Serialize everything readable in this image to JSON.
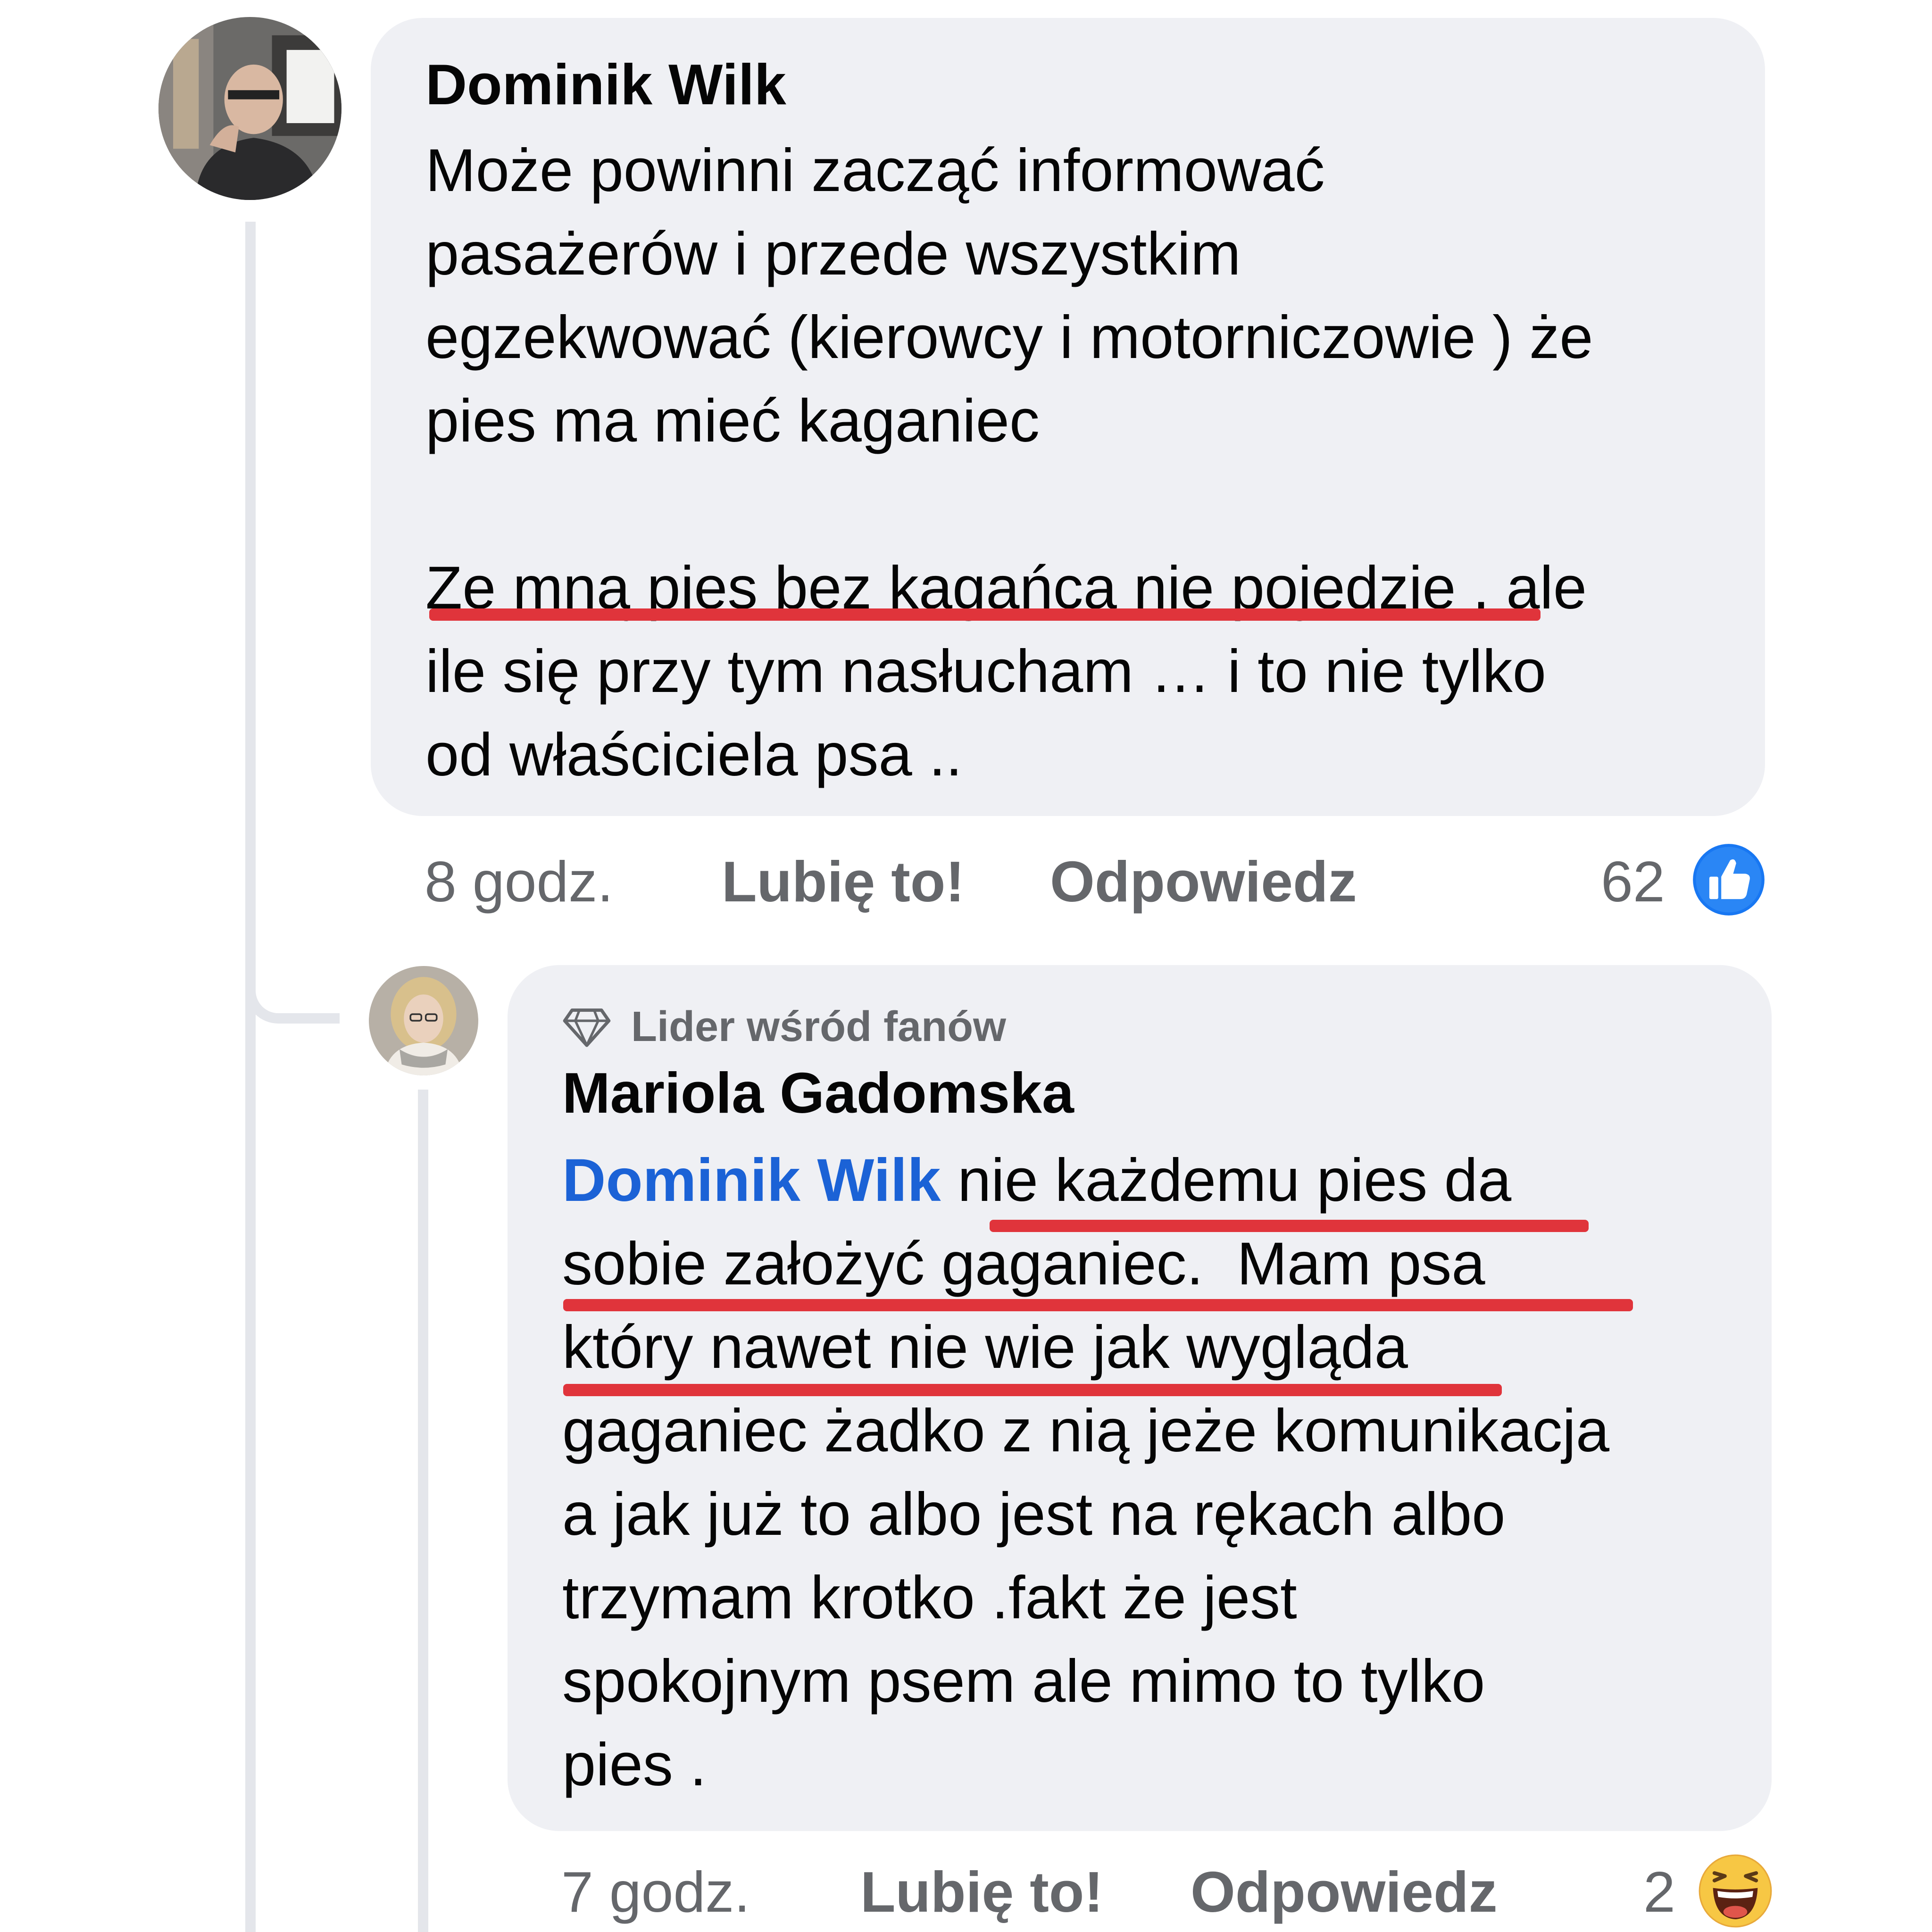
{
  "comments": [
    {
      "author": "Dominik Wilk",
      "text_lines": [
        "Może powinni zacząć informować",
        "pasażerów i przede wszystkim",
        "egzekwować (kierowcy i motorniczowie ) że",
        "pies ma mieć kaganiec"
      ],
      "text_lines_2": [
        "Ze mną pies bez kagańca nie pojedzie , ale",
        "ile się przy tym nasłucham … i to nie tylko",
        "od właściciela psa .."
      ],
      "time": "8 godz.",
      "like_label": "Lubię to!",
      "reply_label": "Odpowiedz",
      "reaction_count": "62",
      "reaction_icon": "like-icon"
    },
    {
      "badge": "Lider wśród fanów",
      "badge_icon": "diamond-icon",
      "author": "Mariola Gadomska",
      "mention": "Dominik Wilk",
      "first_line_rest": " nie każdemu pies da",
      "text_lines": [
        "sobie założyć gaganiec.  Mam psa",
        "który nawet nie wie jak wygląda",
        "gaganiec żadko z nią jeże komunikacja",
        "a jak już to albo jest na rękach albo",
        "trzymam krotko .fakt że jest",
        "spokojnym psem ale mimo to tylko",
        "pies ."
      ],
      "time": "7 godz.",
      "like_label": "Lubię to!",
      "reply_label": "Odpowiedz",
      "reaction_count": "2",
      "reaction_icon": "haha-emoji-icon"
    }
  ],
  "colors": {
    "bubble": "#eff0f4",
    "mention": "#1b62d6",
    "underline_annotation": "#e0343b",
    "like_blue": "#1877f2",
    "meta_gray": "#65676b"
  }
}
